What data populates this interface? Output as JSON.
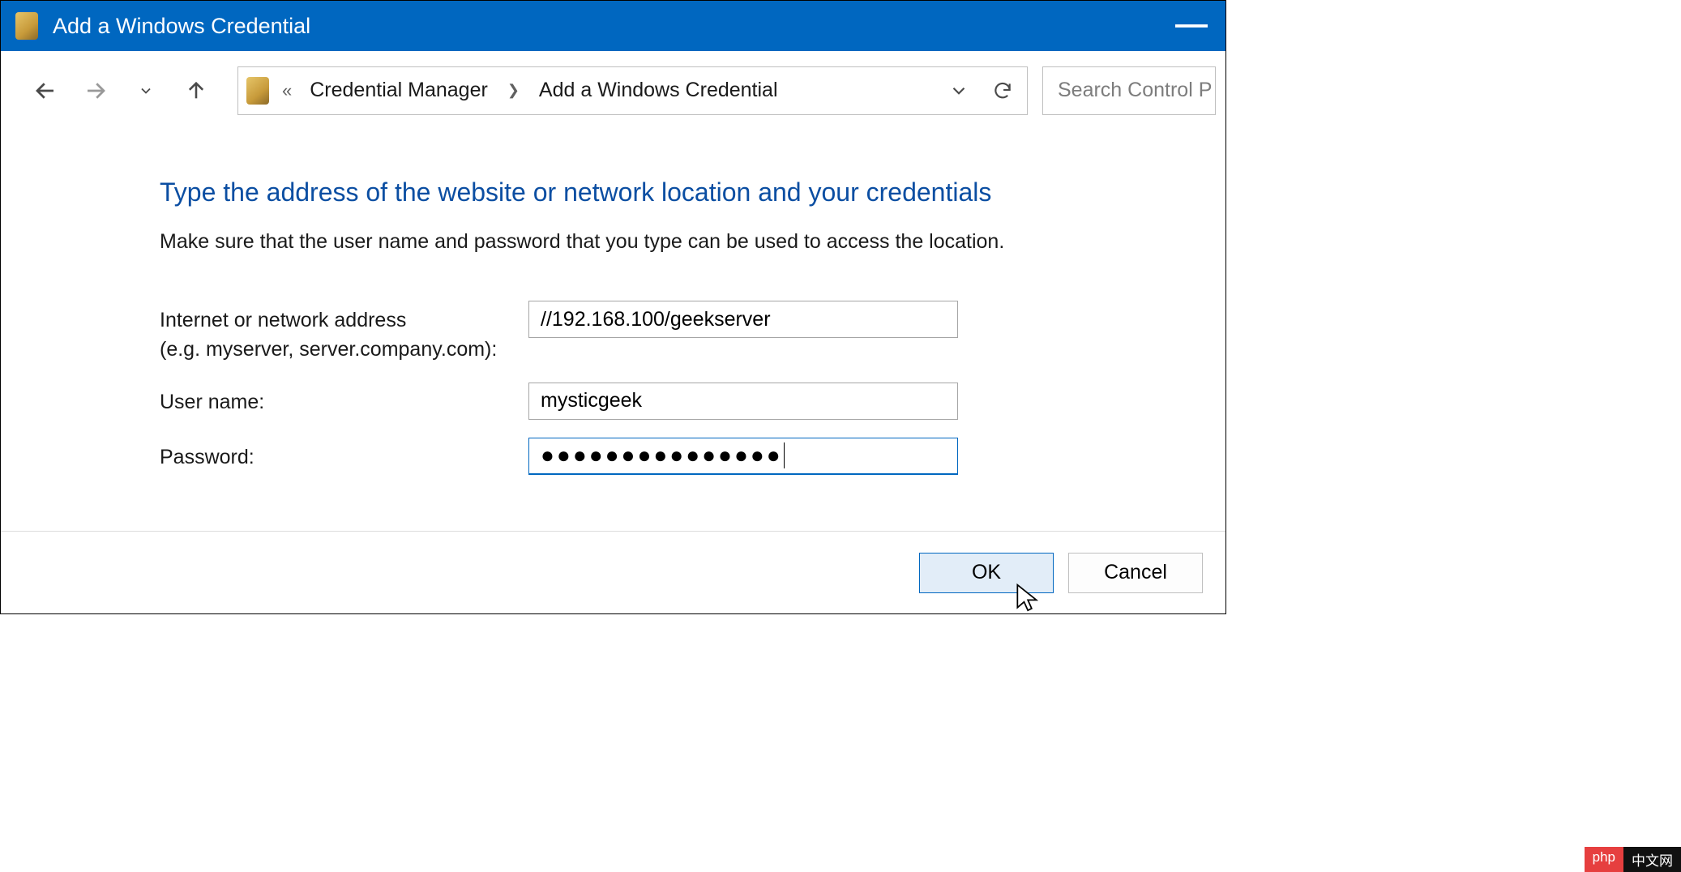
{
  "titlebar": {
    "title": "Add a Windows Credential"
  },
  "address": {
    "seg1": "Credential Manager",
    "seg2": "Add a Windows Credential"
  },
  "search": {
    "placeholder": "Search Control P"
  },
  "content": {
    "heading": "Type the address of the website or network location and your credentials",
    "subtext": "Make sure that the user name and password that you type can be used to access the location."
  },
  "form": {
    "address_label_line1": "Internet or network address",
    "address_label_line2": "(e.g. myserver, server.company.com):",
    "address_value": "//192.168.100/geekserver",
    "username_label": "User name:",
    "username_value": "mysticgeek",
    "password_label": "Password:",
    "password_mask": "●●●●●●●●●●●●●●●"
  },
  "buttons": {
    "ok": "OK",
    "cancel": "Cancel"
  },
  "badge": {
    "left": "php",
    "right": "中文网"
  }
}
